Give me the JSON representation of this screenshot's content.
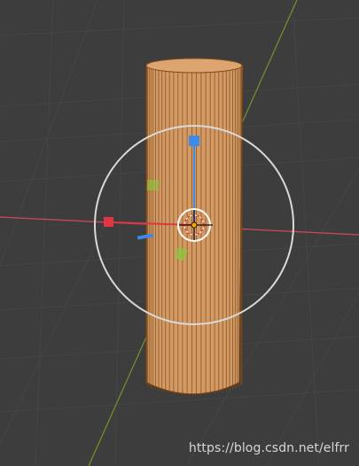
{
  "watermark": "https://blog.csdn.net/elfrr",
  "colors": {
    "background": "#3d3d3d",
    "grid_line": "#454545",
    "x_axis": "#c94a57",
    "y_axis": "#6f8f2a",
    "cylinder_body": "#d49a63",
    "cylinder_edge": "#6b3c15",
    "gizmo_ring": "#d9d9d9",
    "gizmo_x": "#e03545",
    "gizmo_y": "#8cc63e",
    "gizmo_z": "#3d8be8",
    "cursor_red": "#e04040"
  },
  "icons": {
    "origin": "object-origin-icon",
    "cursor": "3d-cursor-icon"
  }
}
